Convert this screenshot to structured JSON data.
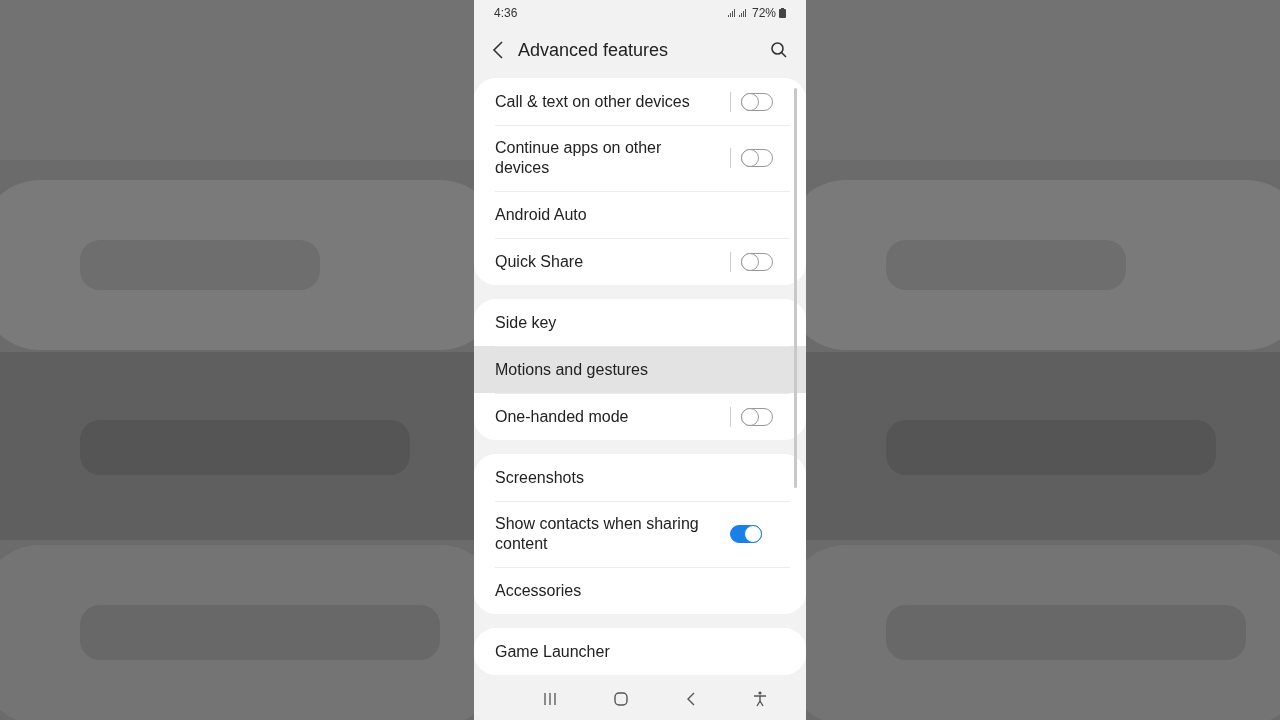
{
  "status_bar": {
    "time": "4:36",
    "battery": "72%"
  },
  "header": {
    "title": "Advanced features"
  },
  "groups": [
    {
      "items": [
        {
          "label": "Call & text on other devices",
          "kind": "switch-link",
          "on": false,
          "selected": false
        },
        {
          "label": "Continue apps on other devices",
          "kind": "switch-link",
          "on": false,
          "selected": false
        },
        {
          "label": "Android Auto",
          "kind": "link",
          "selected": false
        },
        {
          "label": "Quick Share",
          "kind": "switch-link",
          "on": false,
          "selected": false
        }
      ]
    },
    {
      "items": [
        {
          "label": "Side key",
          "kind": "link",
          "selected": false
        },
        {
          "label": "Motions and gestures",
          "kind": "link",
          "selected": true
        },
        {
          "label": "One-handed mode",
          "kind": "switch-link",
          "on": false,
          "selected": false
        }
      ]
    },
    {
      "items": [
        {
          "label": "Screenshots",
          "kind": "link",
          "selected": false
        },
        {
          "label": "Show contacts when sharing content",
          "kind": "switch",
          "on": true,
          "selected": false
        },
        {
          "label": "Accessories",
          "kind": "link",
          "selected": false
        }
      ]
    },
    {
      "items": [
        {
          "label": "Game Launcher",
          "kind": "link",
          "selected": false
        }
      ]
    }
  ]
}
